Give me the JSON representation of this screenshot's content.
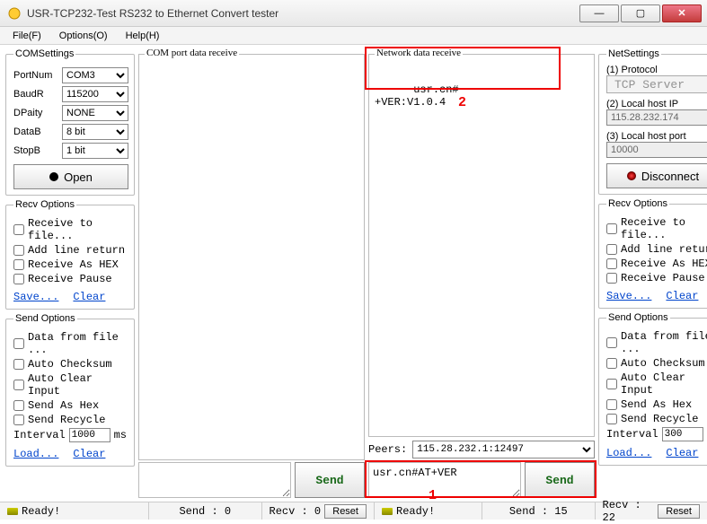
{
  "window": {
    "title": "USR-TCP232-Test  RS232 to Ethernet Convert tester"
  },
  "menu": {
    "file": "File(F)",
    "options": "Options(O)",
    "help": "Help(H)"
  },
  "comSettings": {
    "legend": "COMSettings",
    "portnum_lbl": "PortNum",
    "portnum": "COM3",
    "baud_lbl": "BaudR",
    "baud": "115200",
    "parity_lbl": "DPaity",
    "parity": "NONE",
    "datab_lbl": "DataB",
    "datab": "8 bit",
    "stopb_lbl": "StopB",
    "stopb": "1 bit",
    "open_btn": "Open"
  },
  "netSettings": {
    "legend": "NetSettings",
    "proto_lbl": "(1) Protocol",
    "proto": "TCP Server",
    "ip_lbl": "(2) Local host IP",
    "ip": "115.28.232.174",
    "port_lbl": "(3) Local host port",
    "port": "10000",
    "disconnect_btn": "Disconnect"
  },
  "recvOpt": {
    "legend": "Recv Options",
    "to_file": "Receive to file...",
    "add_line": "Add line return",
    "as_hex": "Receive As HEX",
    "pause": "Receive Pause",
    "save": "Save...",
    "clear": "Clear"
  },
  "sendOpt": {
    "legend": "Send Options",
    "from_file": "Data from file ...",
    "checksum": "Auto Checksum",
    "clear_input": "Auto Clear Input",
    "as_hex": "Send As Hex",
    "recycle": "Send Recycle",
    "interval_lbl": "Interval",
    "interval_left": "1000",
    "interval_right": "300",
    "ms": "ms",
    "load": "Load...",
    "clear": "Clear"
  },
  "comArea": {
    "legend": "COM port data receive",
    "text": ""
  },
  "netArea": {
    "legend": "Network data receive",
    "text": "usr.cn#\n+VER:V1.0.4"
  },
  "peers": {
    "label": "Peers:",
    "value": "115.28.232.1:12497"
  },
  "sendLeft": {
    "value": "",
    "btn": "Send"
  },
  "sendRight": {
    "value": "usr.cn#AT+VER",
    "btn": "Send"
  },
  "status": {
    "ready": "Ready!",
    "l_send": "Send : 0",
    "l_recv": "Recv : 0",
    "r_send": "Send : 15",
    "r_recv": "Recv : 22",
    "reset": "Reset"
  },
  "annot": {
    "one": "1",
    "two": "2"
  }
}
